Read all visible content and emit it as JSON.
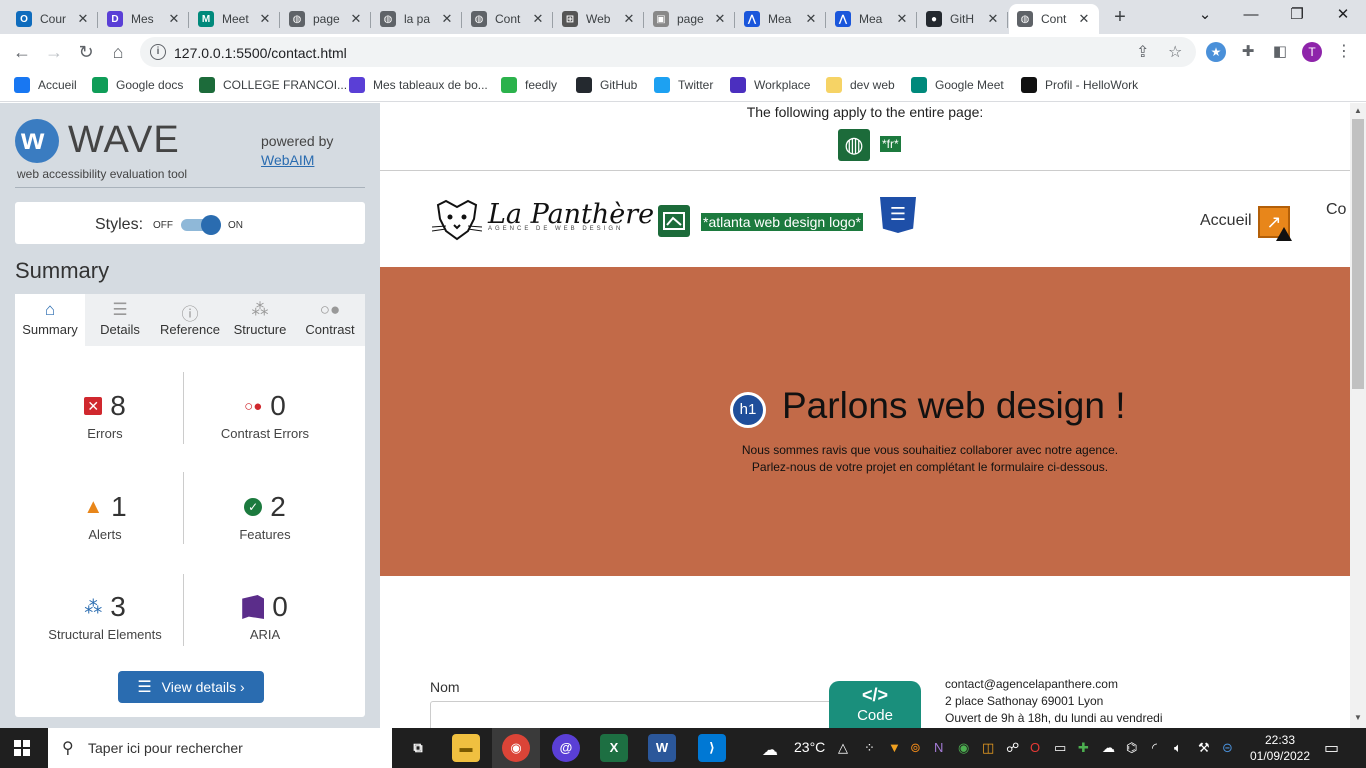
{
  "browser": {
    "tabs": [
      {
        "title": "Cour",
        "icon": "outlook-icon",
        "color": "#0f6cbd",
        "glyph": "O"
      },
      {
        "title": "Mes",
        "icon": "notion-like-icon",
        "color": "#5a3fd6",
        "glyph": "D"
      },
      {
        "title": "Meet",
        "icon": "google-meet-icon",
        "color": "#00897b",
        "glyph": "M"
      },
      {
        "title": "page",
        "icon": "globe-icon",
        "color": "#5f6368",
        "glyph": "◍"
      },
      {
        "title": "la pa",
        "icon": "globe-icon",
        "color": "#5f6368",
        "glyph": "◍"
      },
      {
        "title": "Cont",
        "icon": "globe-icon",
        "color": "#5f6368",
        "glyph": "◍"
      },
      {
        "title": "Web",
        "icon": "webaim-icon",
        "color": "#555555",
        "glyph": "⊞"
      },
      {
        "title": "page",
        "icon": "image-icon",
        "color": "#888888",
        "glyph": "▣"
      },
      {
        "title": "Mea",
        "icon": "meta-icon",
        "color": "#1a56db",
        "glyph": "⋀"
      },
      {
        "title": "Mea",
        "icon": "meta-icon",
        "color": "#1a56db",
        "glyph": "⋀"
      },
      {
        "title": "GitH",
        "icon": "github-icon",
        "color": "#24292f",
        "glyph": "●"
      },
      {
        "title": "Cont",
        "icon": "globe-icon",
        "color": "#5f6368",
        "glyph": "◍",
        "active": true
      }
    ],
    "url": "127.0.0.1:5500/contact.html",
    "profile_initial": "T",
    "bookmarks": [
      {
        "label": "Accueil",
        "icon": "facebook-icon",
        "color": "#1877f2"
      },
      {
        "label": "Google docs",
        "icon": "google-docs-icon",
        "color": "#0f9d58"
      },
      {
        "label": "COLLEGE FRANCOI...",
        "icon": "college-icon",
        "color": "#1c6b3a"
      },
      {
        "label": "Mes tableaux de bo...",
        "icon": "board-icon",
        "color": "#5a3fd6"
      },
      {
        "label": "feedly",
        "icon": "feedly-icon",
        "color": "#2bb24c"
      },
      {
        "label": "GitHub",
        "icon": "github-icon",
        "color": "#24292f"
      },
      {
        "label": "Twitter",
        "icon": "twitter-icon",
        "color": "#1da1f2"
      },
      {
        "label": "Workplace",
        "icon": "workplace-icon",
        "color": "#4b2fbf"
      },
      {
        "label": "dev web",
        "icon": "folder-icon",
        "color": "#f6d365"
      },
      {
        "label": "Google Meet",
        "icon": "google-meet-icon",
        "color": "#00897b"
      },
      {
        "label": "Profil - HelloWork",
        "icon": "hellowork-icon",
        "color": "#111111"
      }
    ]
  },
  "wave": {
    "title": "WAVE",
    "subtitle": "web accessibility evaluation tool",
    "powered_by": "powered by",
    "webaim": "WebAIM",
    "styles_label": "Styles:",
    "off": "OFF",
    "on": "ON",
    "summary_heading": "Summary",
    "tabs": [
      {
        "label": "Summary",
        "icon": "home-icon",
        "active": true
      },
      {
        "label": "Details",
        "icon": "list-icon"
      },
      {
        "label": "Reference",
        "icon": "info-icon"
      },
      {
        "label": "Structure",
        "icon": "structure-icon"
      },
      {
        "label": "Contrast",
        "icon": "contrast-icon"
      }
    ],
    "stats": {
      "errors": {
        "count": "8",
        "label": "Errors"
      },
      "contrast_errors": {
        "count": "0",
        "label": "Contrast Errors"
      },
      "alerts": {
        "count": "1",
        "label": "Alerts"
      },
      "features": {
        "count": "2",
        "label": "Features"
      },
      "structural": {
        "count": "3",
        "label": "Structural Elements"
      },
      "aria": {
        "count": "0",
        "label": "ARIA"
      }
    },
    "view_details": "View details ›"
  },
  "page": {
    "apply_text": "The following apply to the entire page:",
    "lang_badge": "*fr*",
    "logo_text": "La Panthère",
    "logo_sub": "AGENCE DE WEB DESIGN",
    "logo_alt": "*atlanta web design logo*",
    "nav_accueil": "Accueil",
    "nav_next": "Co",
    "h1_badge": "h1",
    "h1": "Parlons web design !",
    "hero_p1": "Nous sommes ravis que vous souhaitiez collaborer avec notre agence.",
    "hero_p2": "Parlez-nous de votre projet en complétant le formulaire ci-dessous.",
    "form_label_nom": "Nom",
    "code_badge": "Code",
    "contact_email": "contact@agencelapanthere.com",
    "contact_address": "2 place Sathonay 69001 Lyon",
    "contact_hours": "Ouvert de 9h à 18h, du lundi au vendredi"
  },
  "taskbar": {
    "search_placeholder": "Taper ici pour rechercher",
    "temperature": "23°C",
    "time": "22:33",
    "date": "01/09/2022"
  }
}
